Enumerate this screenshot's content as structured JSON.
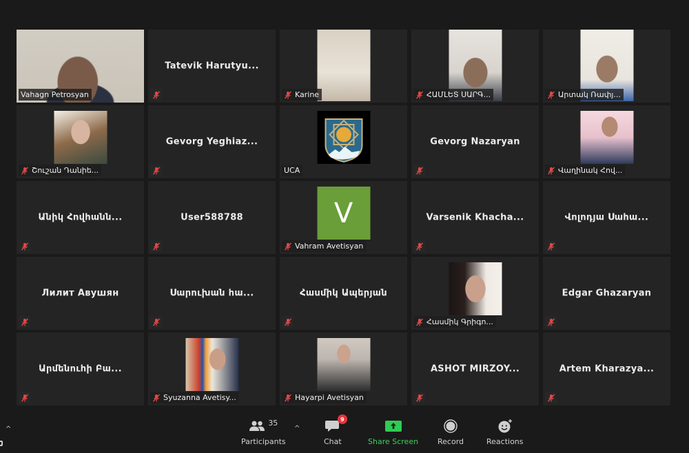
{
  "meeting": {
    "gallery": [
      {
        "name": "Vahagn Petrosyan",
        "video": "camera",
        "muted": false,
        "active_speaker": true,
        "tag_label": "Vahagn Petrosyan"
      },
      {
        "name": "Tatevik  Harutyu...",
        "video": "none",
        "muted": true
      },
      {
        "name": "Karine",
        "video": "camera",
        "muted": true,
        "tag_label": "Karine"
      },
      {
        "name": "ՀԱՄԼԵՏ ՍԱՐԳ...",
        "video": "camera",
        "muted": true,
        "tag_label": "ՀԱՄԼԵՏ ՍԱՐԳ..."
      },
      {
        "name": "Արտակ Ռափյ...",
        "video": "camera",
        "muted": true,
        "tag_label": "Արտակ Ռափյ..."
      },
      {
        "name": "Շուշան Դանիե...",
        "video": "profile-photo",
        "muted": true,
        "tag_label": "Շուշան Դանիե..."
      },
      {
        "name": "Gevorg  Yeghiaz...",
        "video": "none",
        "muted": true
      },
      {
        "name": "UCA",
        "video": "profile-logo",
        "muted": false,
        "tag_label": "UCA"
      },
      {
        "name": "Gevorg Nazaryan",
        "video": "none",
        "muted": true
      },
      {
        "name": "Վաղինակ Հով...",
        "video": "profile-photo",
        "muted": true,
        "tag_label": "Վաղինակ Հով..."
      },
      {
        "name": "Անիկ Հովհանն...",
        "video": "none",
        "muted": true
      },
      {
        "name": "User588788",
        "video": "none",
        "muted": true
      },
      {
        "name": "Vahram Avetisyan",
        "video": "initial",
        "initial": "V",
        "muted": true,
        "tag_label": "Vahram Avetisyan"
      },
      {
        "name": "Varsenik  Khacha...",
        "video": "none",
        "muted": true
      },
      {
        "name": "Վոլոդյա Սահա...",
        "video": "none",
        "muted": true
      },
      {
        "name": "Лилит Авушян",
        "video": "none",
        "muted": true
      },
      {
        "name": "Սարուխան հա...",
        "video": "none",
        "muted": true
      },
      {
        "name": "Հասմիկ Ապերյան",
        "video": "none",
        "muted": true
      },
      {
        "name": "Հասմիկ Գրիգո...",
        "video": "profile-photo",
        "muted": true,
        "tag_label": "Հասմիկ Գրիգո..."
      },
      {
        "name": "Edgar Ghazaryan",
        "video": "none",
        "muted": true
      },
      {
        "name": "Արմենուհի Բա...",
        "video": "none",
        "muted": true
      },
      {
        "name": "Syuzanna Avetisy...",
        "video": "profile-photo",
        "muted": true,
        "tag_label": "Syuzanna Avetisy..."
      },
      {
        "name": "Hayarpi Avetisyan",
        "video": "profile-photo",
        "muted": true,
        "tag_label": "Hayarpi Avetisyan"
      },
      {
        "name": "ASHOT  MIRZOY...",
        "video": "none",
        "muted": true
      },
      {
        "name": "Artem  Kharazya...",
        "video": "none",
        "muted": true
      }
    ]
  },
  "toolbar": {
    "participants_label": "Participants",
    "participants_count": "35",
    "chat_label": "Chat",
    "chat_badge": "9",
    "share_label": "Share Screen",
    "record_label": "Record",
    "reactions_label": "Reactions",
    "caret_glyph": "^"
  },
  "colors": {
    "active_speaker_border": "#c6e468",
    "share_green": "#3fd05c",
    "badge_red": "#e3363c",
    "muted_red": "#e04848"
  }
}
